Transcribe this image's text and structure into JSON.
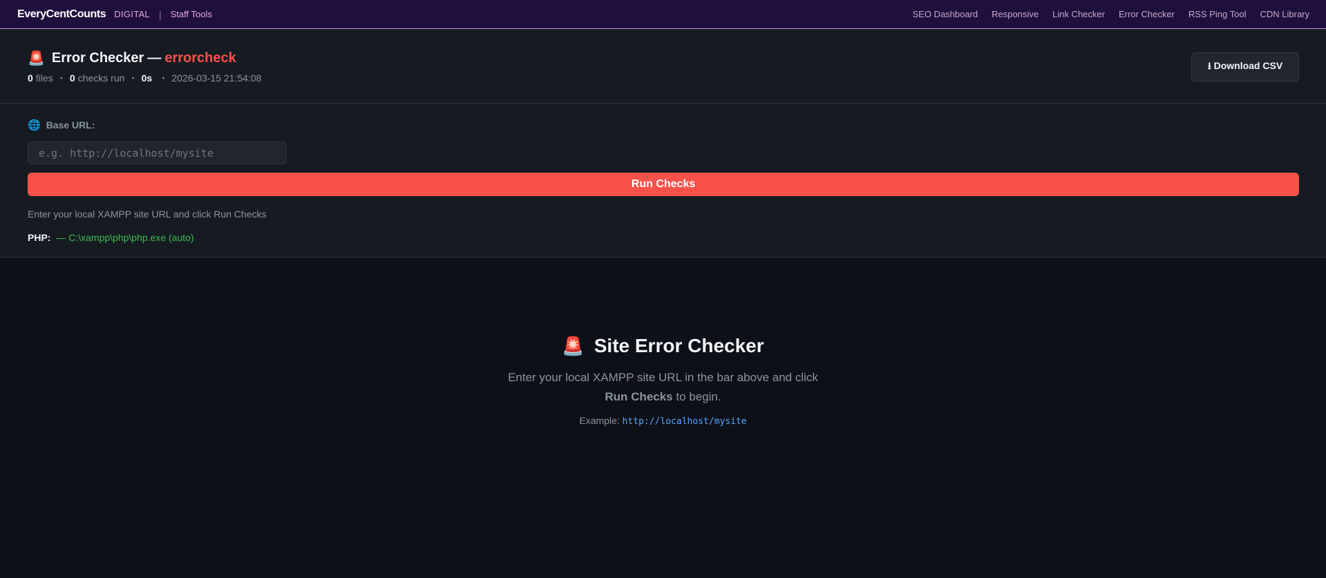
{
  "nav": {
    "brand": "EveryCentCounts",
    "tag": "DIGITAL",
    "separator": "|",
    "subtitle": "Staff Tools",
    "links": [
      "SEO Dashboard",
      "Responsive",
      "Link Checker",
      "Error Checker",
      "RSS Ping Tool",
      "CDN Library"
    ]
  },
  "header": {
    "icon": "🚨",
    "title": "Error Checker",
    "dash": "—",
    "accent": "errorcheck",
    "files_count": "0",
    "files_label": "files",
    "checks_count": "0",
    "checks_label": "checks run",
    "duration": "0s",
    "timestamp": "2026-03-15 21:54:08",
    "download_label": "⭳ Download CSV"
  },
  "form": {
    "globe_icon": "🌐",
    "base_url_label": "Base URL:",
    "url_placeholder": "e.g. http://localhost/mysite",
    "url_value": "",
    "run_label": "Run Checks",
    "hint": "Enter your local XAMPP site URL and click Run Checks",
    "php_label": "PHP:",
    "php_path": "— C:\\xampp\\php\\php.exe (auto)"
  },
  "empty": {
    "icon": "🚨",
    "title": "Site Error Checker",
    "desc_line1": "Enter your local XAMPP site URL in the bar above and click",
    "desc_bold": "Run Checks",
    "desc_end": " to begin.",
    "example_label": "Example: ",
    "example_url": "http://localhost/mysite"
  },
  "colors": {
    "accent_red": "#f85149",
    "nav_bg": "#1f0f3d",
    "php_green": "#3fb950",
    "link_blue": "#58a6ff"
  }
}
